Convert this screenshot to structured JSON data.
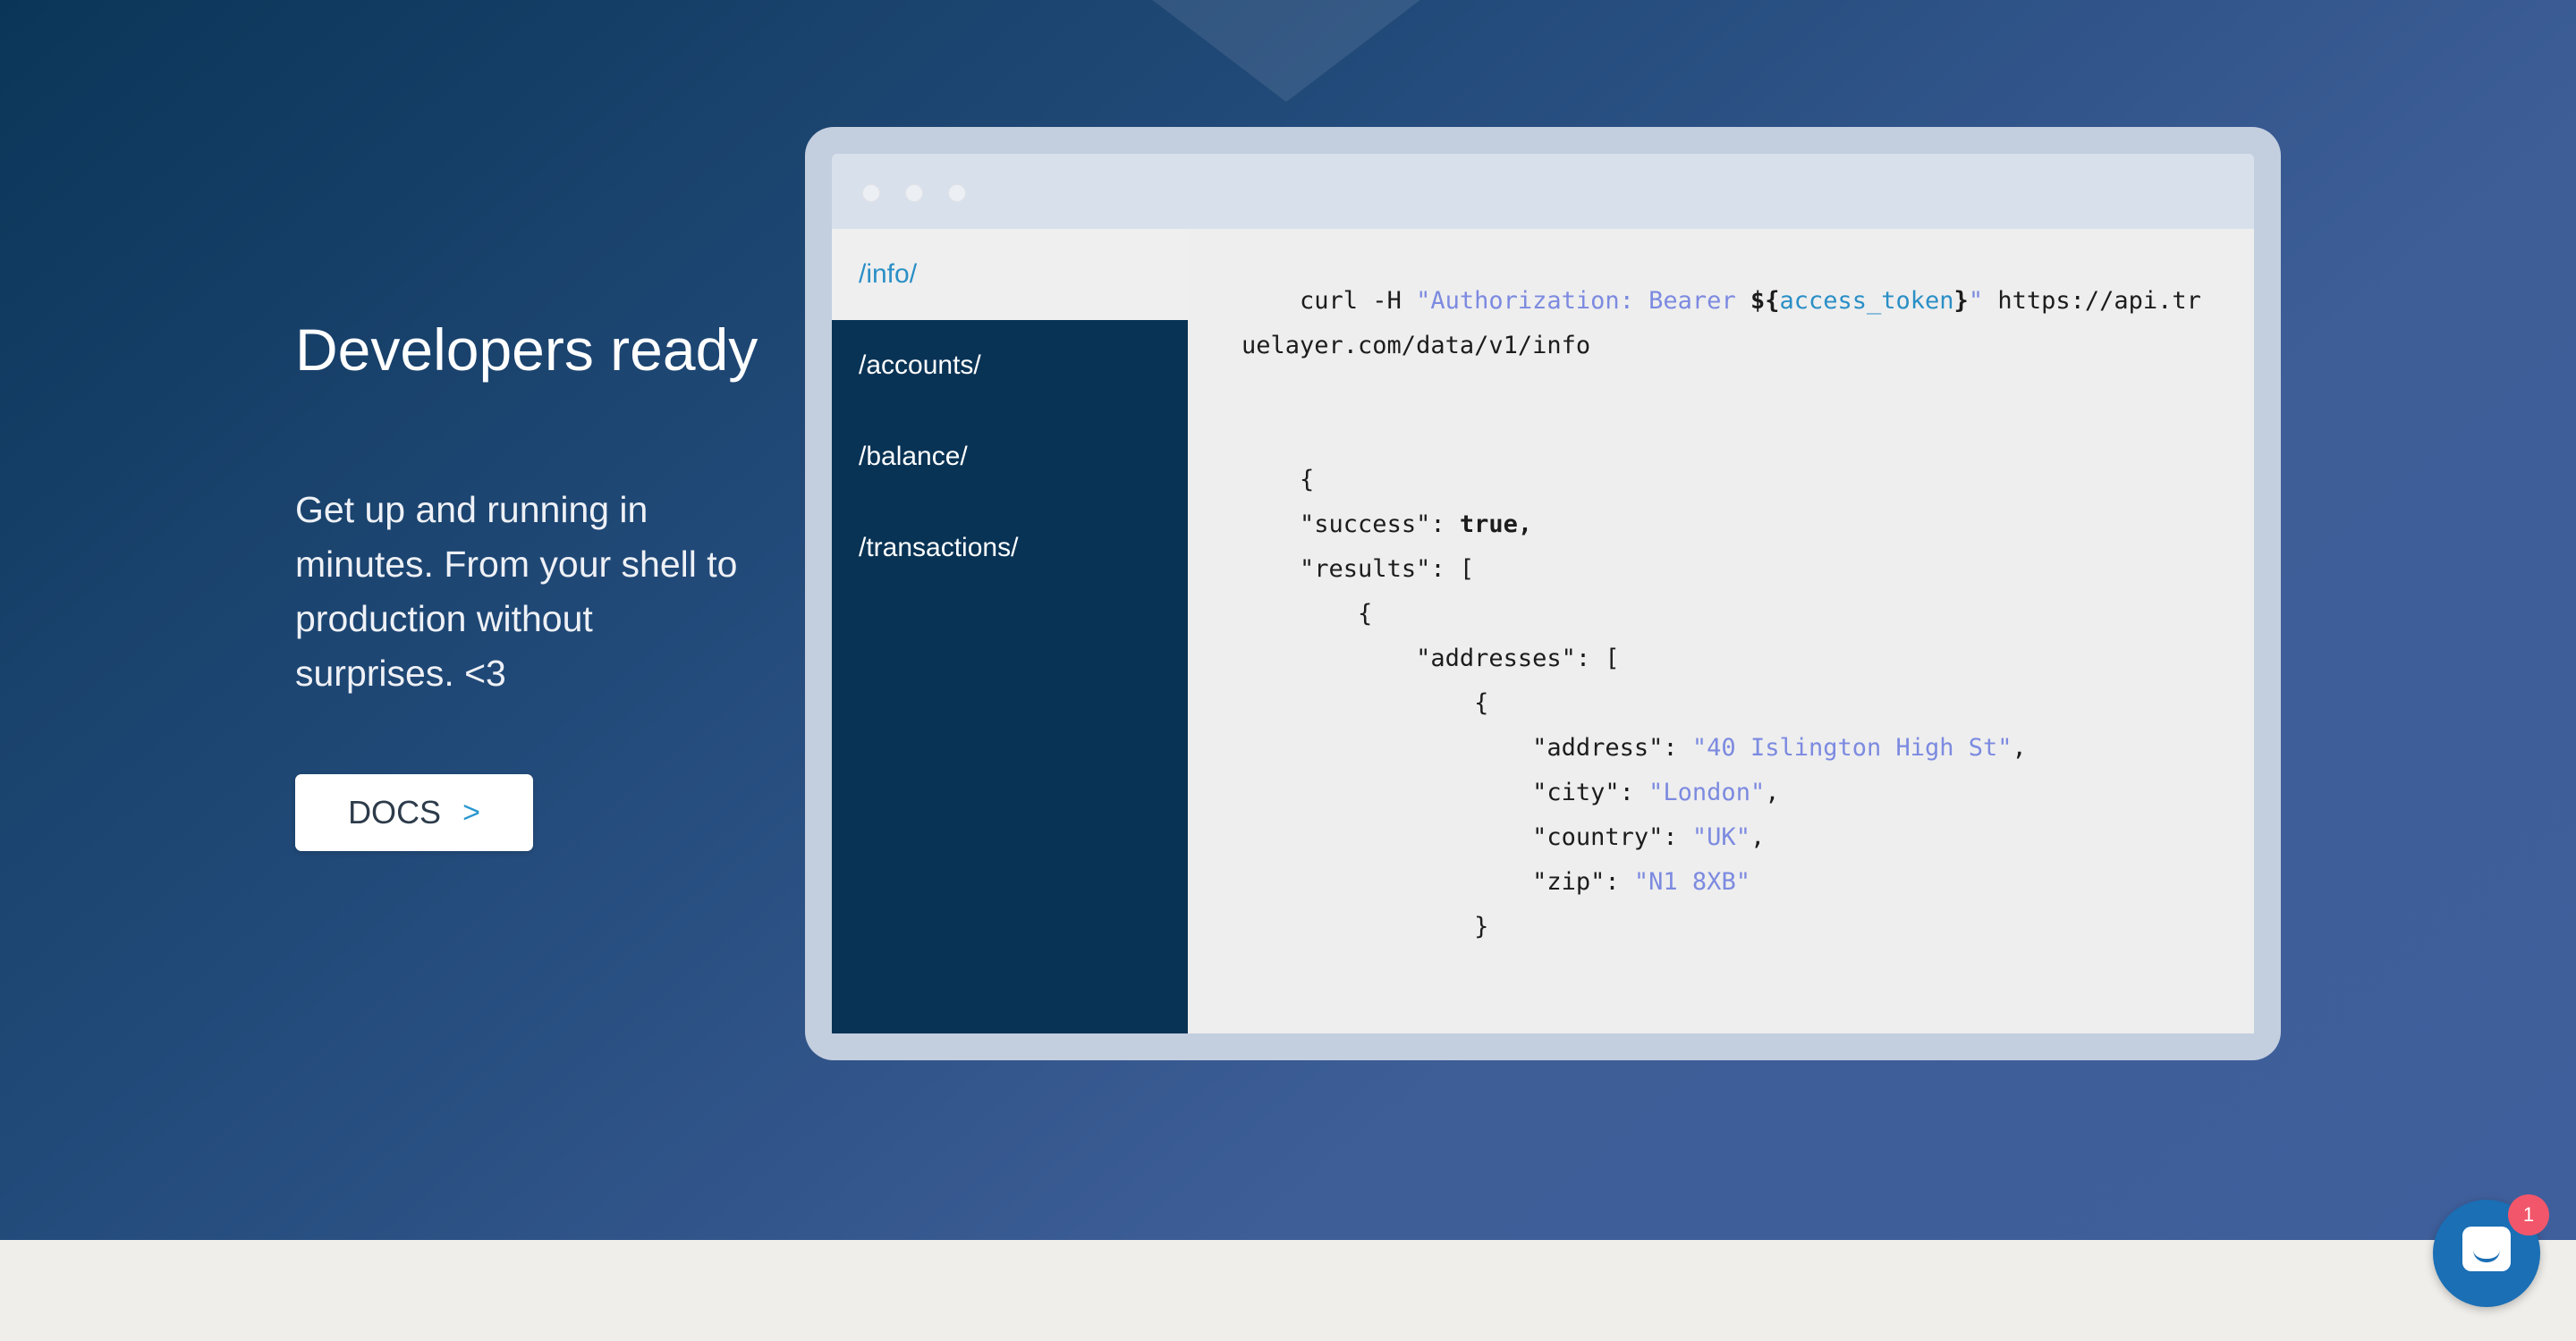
{
  "hero": {
    "headline": "Developers ready",
    "subtext": "Get up and running in minutes. From your shell to production without surprises. <3",
    "docs_button": {
      "label": "DOCS",
      "chevron": ">"
    }
  },
  "code_window": {
    "endpoints": [
      {
        "label": "/info/",
        "active": true
      },
      {
        "label": "/accounts/",
        "active": false
      },
      {
        "label": "/balance/",
        "active": false
      },
      {
        "label": "/transactions/",
        "active": false
      }
    ],
    "request": {
      "command": "curl -H ",
      "header": "\"Authorization: Bearer ",
      "var_open": "${",
      "var_name": "access_token",
      "var_close": "}",
      "header_close": "\"",
      "url_part1": " https://api.tr",
      "url_part2": "uelayer.com/data/v1/info"
    },
    "response": {
      "open_brace": "{",
      "success_key": "\"success\": ",
      "success_value": "true,",
      "results_key": "\"results\": [",
      "item_open": "{",
      "addresses_key": "\"addresses\": [",
      "address_open": "{",
      "address_key": "\"address\": ",
      "address_value": "\"40 Islington High St\"",
      "city_key": "\"city\": ",
      "city_value": "\"London\"",
      "country_key": "\"country\": ",
      "country_value": "\"UK\"",
      "zip_key": "\"zip\": ",
      "zip_value": "\"N1 8XB\"",
      "address_close": "}",
      "comma": ","
    }
  },
  "chat_widget": {
    "icon": "chat-bubble-icon",
    "badge_count": "1"
  },
  "colors": {
    "hero_gradient_start": "#0b3558",
    "hero_gradient_end": "#3f5f9c",
    "sidebar_bg": "#093355",
    "accent": "#2a8fc6",
    "string_color": "#7c8ae0",
    "badge": "#f2566a"
  }
}
